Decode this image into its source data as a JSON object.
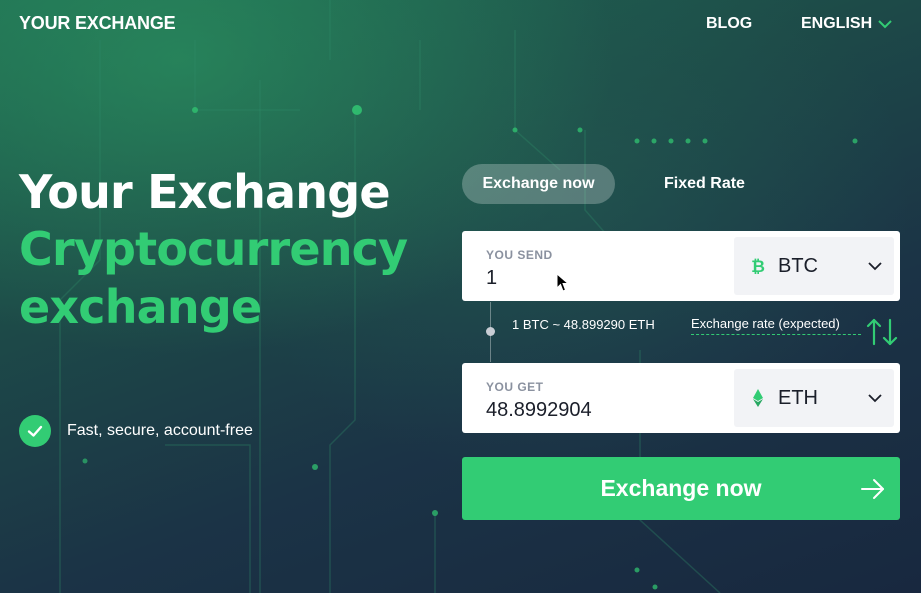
{
  "header": {
    "logo": "YOUR EXCHANGE",
    "nav_blog": "BLOG",
    "nav_language": "ENGLISH"
  },
  "hero": {
    "line1": "Your Exchange",
    "line2": "Cryptocurrency",
    "line3": "exchange",
    "feature": "Fast, secure, account-free"
  },
  "tabs": [
    {
      "label": "Exchange now",
      "active": true
    },
    {
      "label": "Fixed Rate",
      "active": false
    }
  ],
  "send": {
    "label": "YOU SEND",
    "value": "1",
    "currency": "BTC",
    "icon": "bitcoin-icon"
  },
  "rate": {
    "value": "1 BTC ~ 48.899290 ETH",
    "label": "Exchange rate (expected)"
  },
  "get": {
    "label": "YOU GET",
    "value": "48.8992904",
    "currency": "ETH",
    "icon": "ethereum-icon"
  },
  "cta": {
    "label": "Exchange now"
  },
  "colors": {
    "accent": "#32cc74",
    "panel": "#ffffff",
    "select_bg": "#f2f3f6",
    "text_dark": "#1b1f2a",
    "label_gray": "#8a919f"
  }
}
